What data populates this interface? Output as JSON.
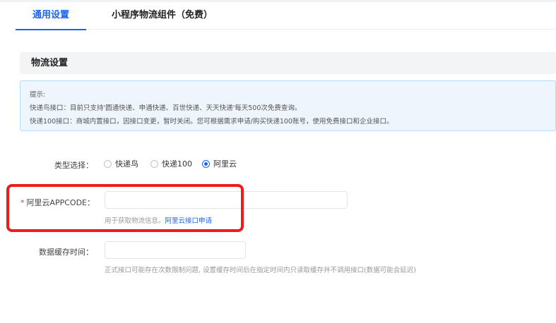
{
  "tabs": [
    {
      "label": "通用设置",
      "active": true
    },
    {
      "label": "小程序物流组件（免费）",
      "active": false
    }
  ],
  "section": {
    "title": "物流设置"
  },
  "tip": {
    "line1": "提示:",
    "line2": "快递鸟接口：目前只支持'圆通快递、申通快递、百世快递、天天快递'每天500次免费查询。",
    "line3": "快递100接口：商城内置接口，因接口变更，暂时关闭。您可根据需求申请/购买快递100账号，使用免费接口和企业接口。"
  },
  "form": {
    "type_label": "类型选择：",
    "type_options": [
      {
        "label": "快递鸟",
        "checked": false
      },
      {
        "label": "快递100",
        "checked": false
      },
      {
        "label": "阿里云",
        "checked": true
      }
    ],
    "appcode": {
      "required_mark": "*",
      "label": "阿里云APPCODE：",
      "value": "",
      "hint_text": "用于获取物流信息。",
      "hint_link": "阿里云接口申请"
    },
    "cache": {
      "label": "数据缓存时间：",
      "value": "",
      "hint": "正式接口可能存在次数限制问题, 设置缓存时间后在指定时间内只读取缓存并不调用接口(数据可能会延迟)"
    }
  },
  "colors": {
    "accent": "#1a64f0",
    "highlight_border": "#ef1b1b",
    "tip_bg": "#eef5fd",
    "required": "#e03b3b"
  }
}
